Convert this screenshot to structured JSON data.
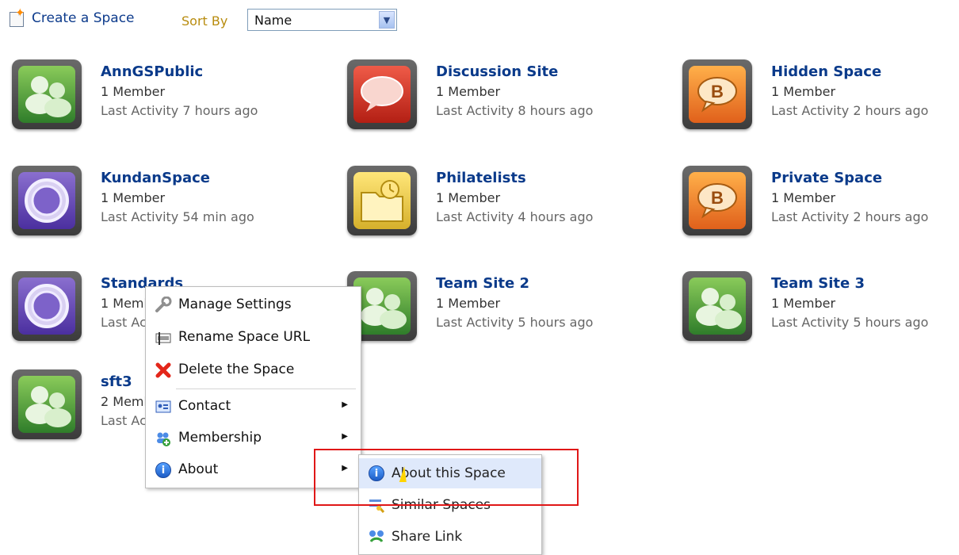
{
  "toolbar": {
    "create_label": "Create a Space",
    "sort_label": "Sort By",
    "sort_value": "Name"
  },
  "spaces": [
    {
      "name": "AnnGSPublic",
      "members": "1 Member",
      "activity": "Last Activity 7 hours ago",
      "icon": "group-icon",
      "color": "#3d8f35"
    },
    {
      "name": "Discussion Site",
      "members": "1 Member",
      "activity": "Last Activity 8 hours ago",
      "icon": "speech-bubble-icon",
      "color": "#d52d1f"
    },
    {
      "name": "Hidden Space",
      "members": "1 Member",
      "activity": "Last Activity 2 hours ago",
      "icon": "blog-bubble-icon",
      "color": "#f07a22"
    },
    {
      "name": "KundanSpace",
      "members": "1 Member",
      "activity": "Last Activity 54 min ago",
      "icon": "porthole-icon",
      "color": "#6245b8"
    },
    {
      "name": "Philatelists",
      "members": "1 Member",
      "activity": "Last Activity 4 hours ago",
      "icon": "folder-clock-icon",
      "color": "#e8c33a"
    },
    {
      "name": "Private Space",
      "members": "1 Member",
      "activity": "Last Activity 2 hours ago",
      "icon": "blog-bubble-icon",
      "color": "#f07a22"
    },
    {
      "name": "Standards",
      "members": "1 Member",
      "activity": "Last Activity",
      "icon": "porthole-icon",
      "color": "#6245b8"
    },
    {
      "name": "Team Site 2",
      "members": "1 Member",
      "activity": "Last Activity 5 hours ago",
      "icon": "group-icon",
      "color": "#3d8f35"
    },
    {
      "name": "Team Site 3",
      "members": "1 Member",
      "activity": "Last Activity 5 hours ago",
      "icon": "group-icon",
      "color": "#3d8f35"
    },
    {
      "name": "sft3",
      "members": "2 Members",
      "activity": "Last Activity",
      "icon": "group-icon",
      "color": "#3d8f35"
    }
  ],
  "menu": {
    "manage": "Manage Settings",
    "rename": "Rename Space URL",
    "delete": "Delete the Space",
    "contact": "Contact",
    "membership": "Membership",
    "about": "About"
  },
  "submenu": {
    "about_space": "About this Space",
    "similar": "Similar Spaces",
    "share": "Share Link"
  },
  "colors": {
    "link": "#0a3a8a",
    "highlight": "#e01717",
    "hover": "#dfe9fb"
  }
}
